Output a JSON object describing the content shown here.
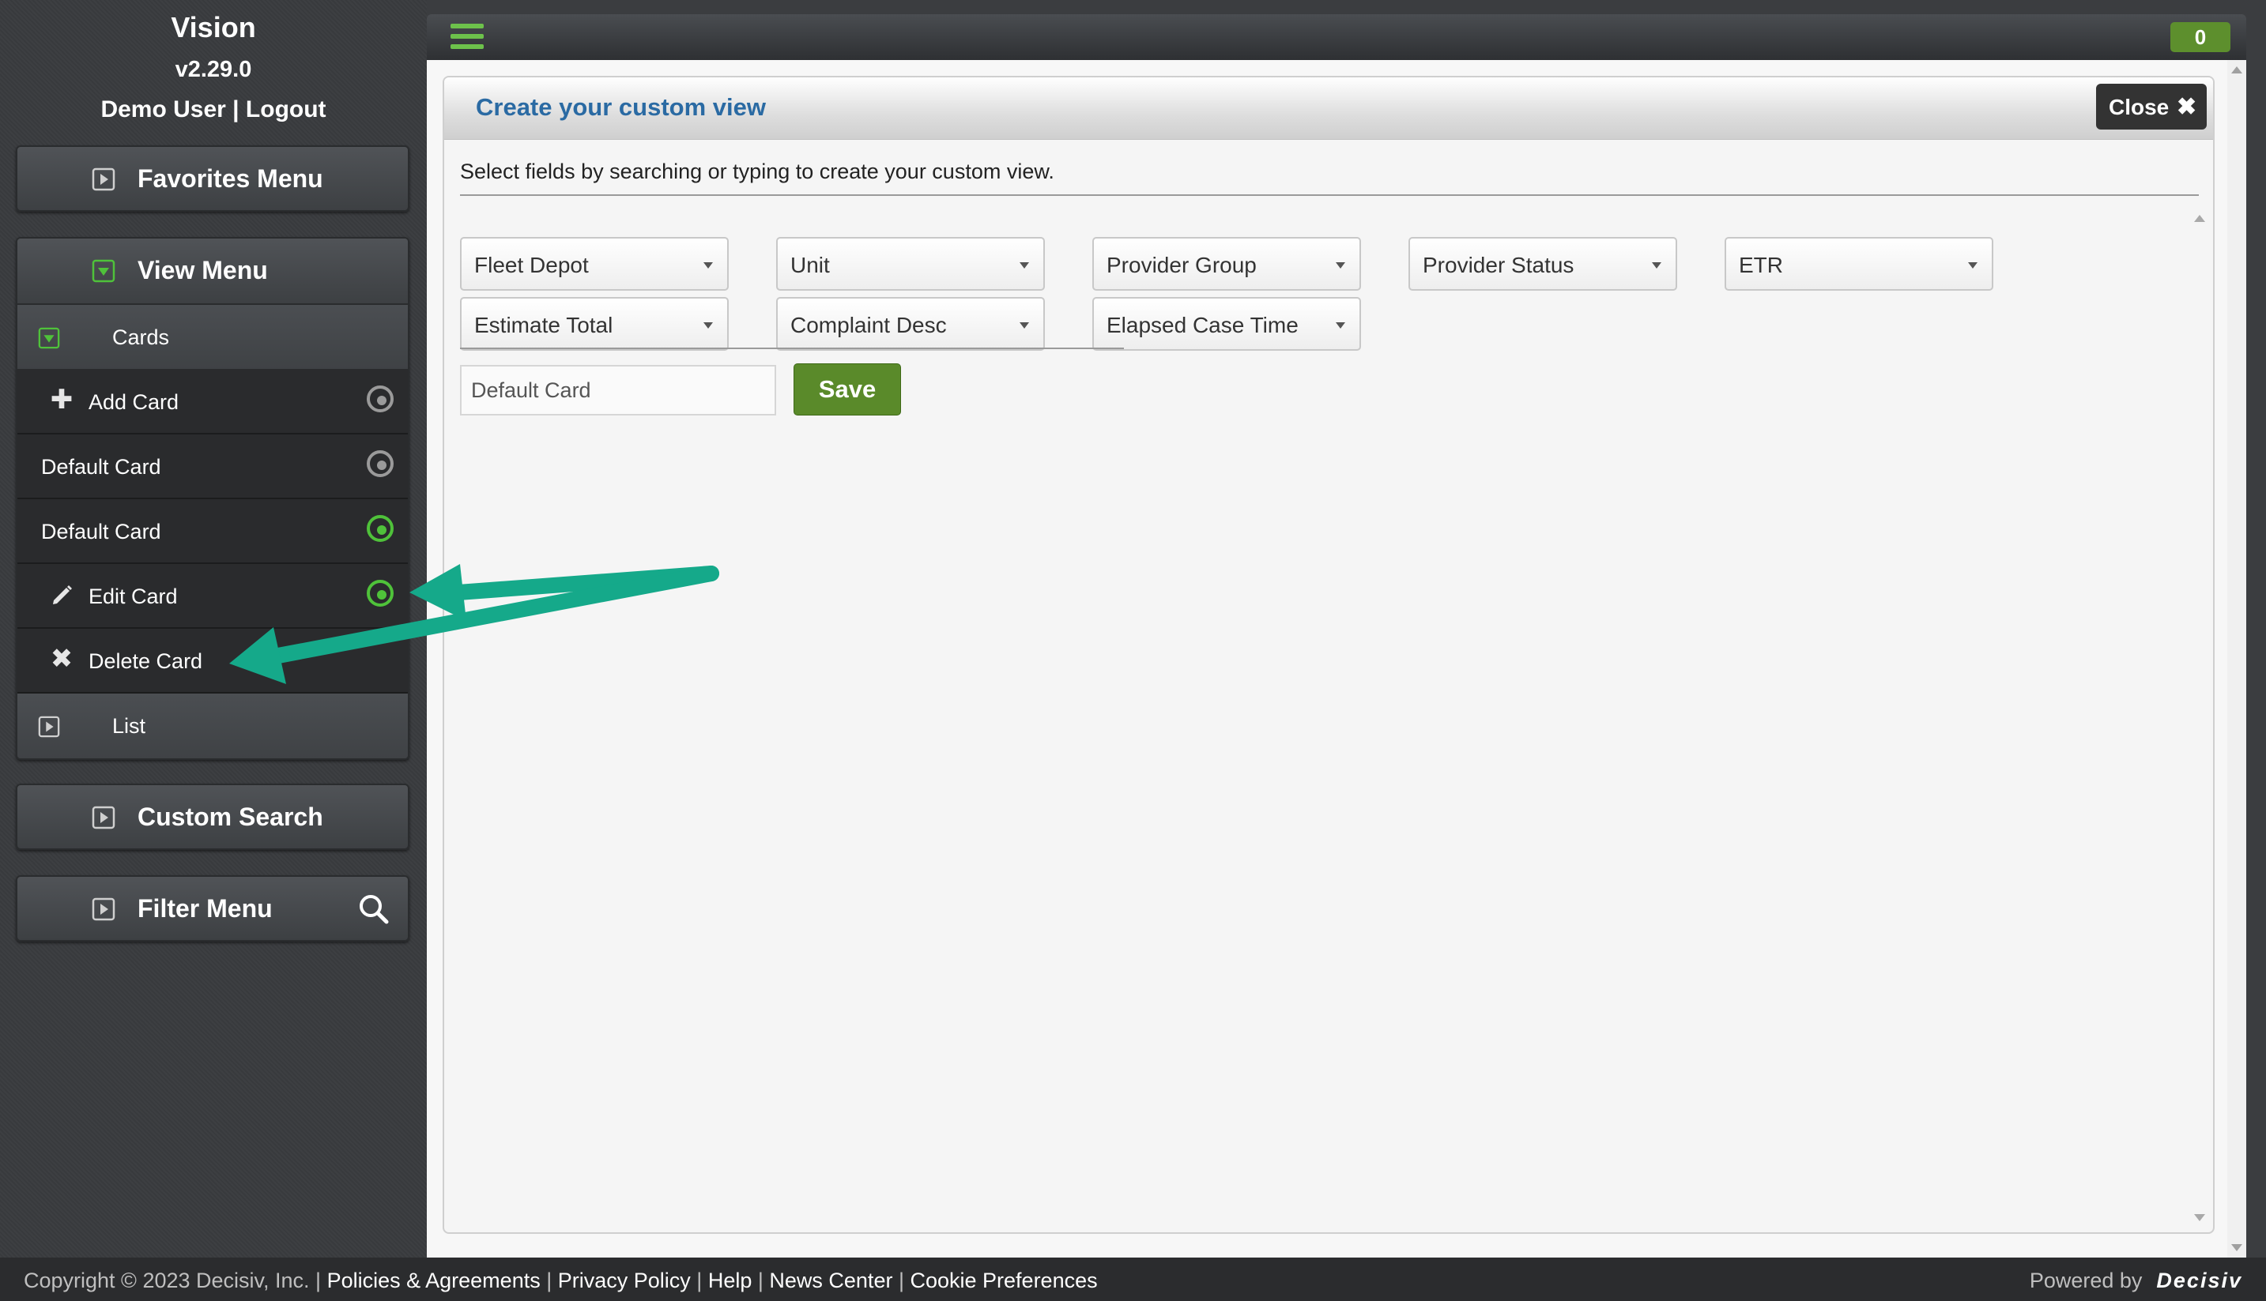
{
  "brand": {
    "title": "Vision",
    "version": "v2.29.0",
    "user": "Demo User",
    "separator": " | ",
    "logout": "Logout"
  },
  "sidebar": {
    "favorites_menu": "Favorites Menu",
    "view_menu": {
      "label": "View Menu",
      "items": [
        {
          "label": "Cards"
        },
        {
          "label": "Add Card"
        },
        {
          "label": "Default Card"
        },
        {
          "label": "Default Card"
        },
        {
          "label": "Edit Card"
        },
        {
          "label": "Delete Card"
        },
        {
          "label": "List"
        }
      ]
    },
    "custom_search": "Custom Search",
    "filter_menu": "Filter Menu"
  },
  "topbar": {
    "count": "0"
  },
  "dialog": {
    "title": "Create your custom view",
    "close_label": "Close",
    "instructions": "Select fields by searching or typing to create your custom view.",
    "fields": [
      "Fleet Depot",
      "Unit",
      "Provider Group",
      "Provider Status",
      "ETR",
      "Estimate Total",
      "Complaint Desc",
      "Elapsed Case Time"
    ],
    "card_name_value": "Default Card",
    "save_label": "Save"
  },
  "footer": {
    "copyright": "Copyright © 2023 Decisiv, Inc. | ",
    "links": [
      "Policies & Agreements",
      "Privacy Policy",
      "Help",
      "News Center",
      "Cookie Preferences"
    ],
    "powered_by": "Powered by",
    "brandmark": "Decisiv"
  },
  "colors": {
    "accent_green": "#4fc23a",
    "save_green": "#5a8a2a",
    "title_blue": "#2a6aa3",
    "arrow_teal": "#15a98a"
  }
}
